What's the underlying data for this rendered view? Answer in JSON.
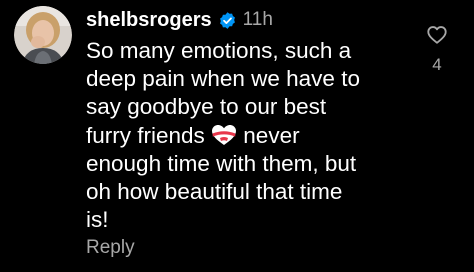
{
  "comment": {
    "username": "shelbsrogers",
    "verified_icon": "verified-badge-icon",
    "timestamp": "11h",
    "text_part1": "So many emotions, such a\ndeep pain when we have to\nsay goodbye to our best\nfurry friends ",
    "emoji": "heart-with-ribbon-icon",
    "text_part2": " never\nenough time with them, but\noh how beautiful that time\nis!",
    "reply_label": "Reply",
    "like_icon": "heart-outline-icon",
    "like_count": "4"
  },
  "colors": {
    "background": "#000000",
    "text": "#ffffff",
    "muted": "#a8a8a8",
    "verified": "#0095f6"
  }
}
